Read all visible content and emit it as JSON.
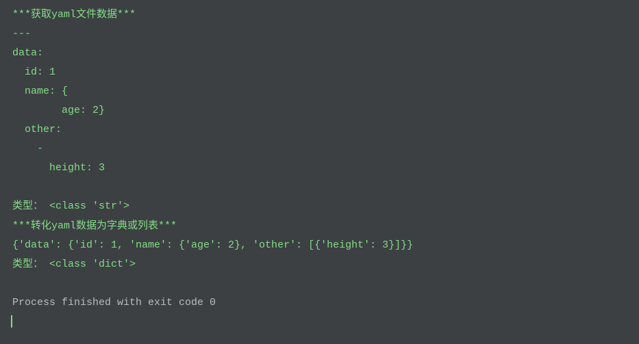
{
  "output": {
    "line1": "***获取yaml文件数据***",
    "line2": "---",
    "line3": "data:",
    "line4": "  id: 1",
    "line5": "  name: {",
    "line6": "        age: 2}",
    "line7": "  other:",
    "line8": "    -",
    "line9": "      height: 3",
    "line10_prefix": "类型：",
    "line10_value": " <class 'str'>",
    "line11": "***转化yaml数据为字典或列表***",
    "line12": "{'data': {'id': 1, 'name': {'age': 2}, 'other': [{'height': 3}]}}",
    "line13_prefix": "类型：",
    "line13_value": " <class 'dict'>",
    "line14": "Process finished with exit code 0"
  }
}
